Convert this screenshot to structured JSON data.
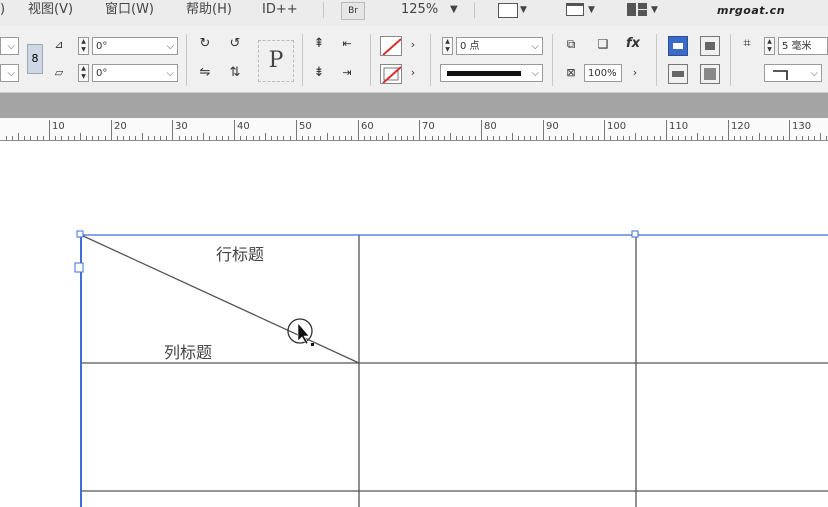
{
  "menubar": {
    "items": [
      "视图(V)",
      "窗口(W)",
      "帮助(H)",
      "ID++"
    ],
    "zoom": "125%",
    "brand": "mrgoat.cn"
  },
  "toolbar": {
    "angle_top": "0°",
    "angle_bottom": "0°",
    "stroke_weight": "0 点",
    "opacity": "100%",
    "measure": "5 毫米"
  },
  "ruler": {
    "labels": [
      "10",
      "20",
      "30",
      "40",
      "50",
      "60",
      "70",
      "80",
      "90",
      "100",
      "110",
      "120",
      "130"
    ]
  },
  "table": {
    "row_header": "行标题",
    "col_header": "列标题"
  },
  "colors": {
    "selection": "#3d6fd6",
    "table_line": "#555555",
    "toolbar_bg": "#f0f0f0",
    "gray_band": "#a4a4a4",
    "no_fill_red": "#d9302c"
  }
}
